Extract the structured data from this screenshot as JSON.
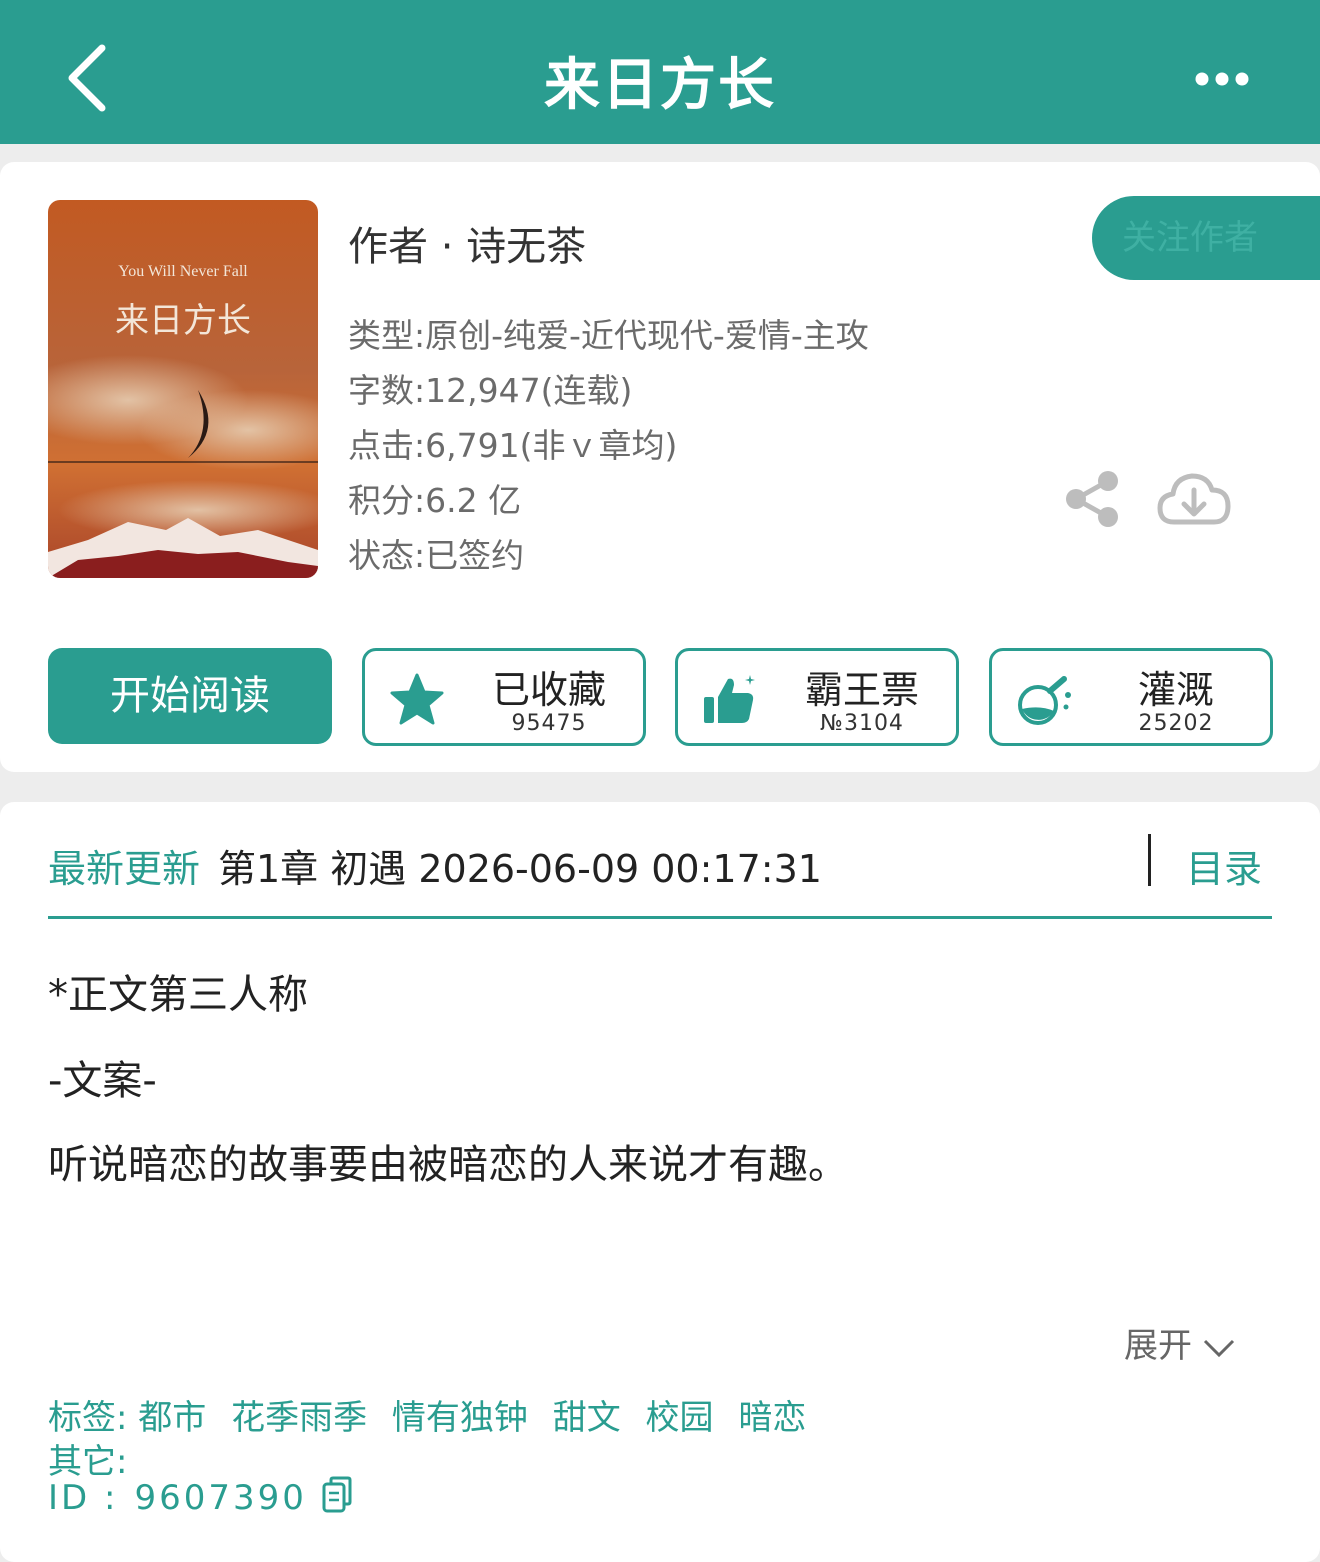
{
  "header": {
    "title": "来日方长"
  },
  "book": {
    "author": "作者 · 诗无茶",
    "follow_label": "关注作者",
    "info": {
      "genre": "类型:原创-纯爱-近代现代-爱情-主攻",
      "words": "字数:12,947(连载)",
      "clicks": "点击:6,791(非ｖ章均)",
      "score": "积分:6.2 亿",
      "status": "状态:已签约"
    },
    "cover": {
      "subtitle": "You Will Never Fall",
      "title": "来日方长"
    }
  },
  "actions": {
    "read_label": "开始阅读",
    "favorite": {
      "label": "已收藏",
      "count": "95475"
    },
    "vote": {
      "label": "霸王票",
      "count": "№3104"
    },
    "water": {
      "label": "灌溉",
      "count": "25202"
    }
  },
  "update": {
    "label": "最新更新",
    "chapter": "第1章 初遇 2026-06-09 00:17:31",
    "toc_label": "目录"
  },
  "description": {
    "line1": "*正文第三人称",
    "line2": "-文案-",
    "line3": "听说暗恋的故事要由被暗恋的人来说才有趣。",
    "expand_label": "展开"
  },
  "meta": {
    "tags_label": "标签:",
    "tags": [
      "都市",
      "花季雨季",
      "情有独钟",
      "甜文",
      "校园",
      "暗恋"
    ],
    "other_label": "其它:",
    "id_label": "ID  :",
    "id_value": "9607390"
  },
  "colors": {
    "accent": "#2a9d90",
    "background": "#ededed"
  }
}
